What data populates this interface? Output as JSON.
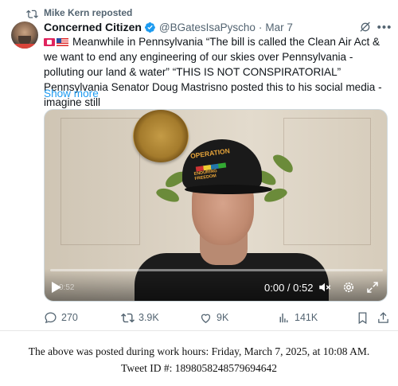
{
  "repost": {
    "label": "Mike Kern reposted"
  },
  "tweet": {
    "author_name": "Concerned Citizen",
    "handle": "@BGatesIsaPyscho",
    "separator": "·",
    "date": "Mar 7",
    "text": "Meanwhile in Pennsylvania “The bill is called the Clean Air Act & we want to end any engineering of our skies over Pennsylvania - polluting our land & water” “THIS IS NOT CONSPIRATORIAL” Pennsylvania Senator Doug Mastrisno posted this to his social media - imagine still",
    "show_more": "Show more",
    "leading_emoji": [
      "siren-emoji",
      "us-flag-emoji"
    ]
  },
  "video": {
    "time_display": "0:00 / 0:52",
    "thumb_time": "0:52",
    "cap_text_line1": "OPERATION",
    "cap_text_line2": "ENDURING",
    "cap_text_line3": "FREEDOM",
    "controls": [
      "play-icon",
      "mute-icon",
      "settings-icon",
      "fullscreen-icon"
    ]
  },
  "actions": {
    "replies": "270",
    "reposts": "3.9K",
    "likes": "9K",
    "views": "141K"
  },
  "footer": {
    "line1": "The above was posted during work hours: Friday, March 7, 2025, at 10:08 AM.",
    "line2": "Tweet ID #: 1898058248579694642"
  },
  "colors": {
    "accent": "#1d9bf0",
    "muted": "#536471",
    "text": "#0f1419"
  }
}
